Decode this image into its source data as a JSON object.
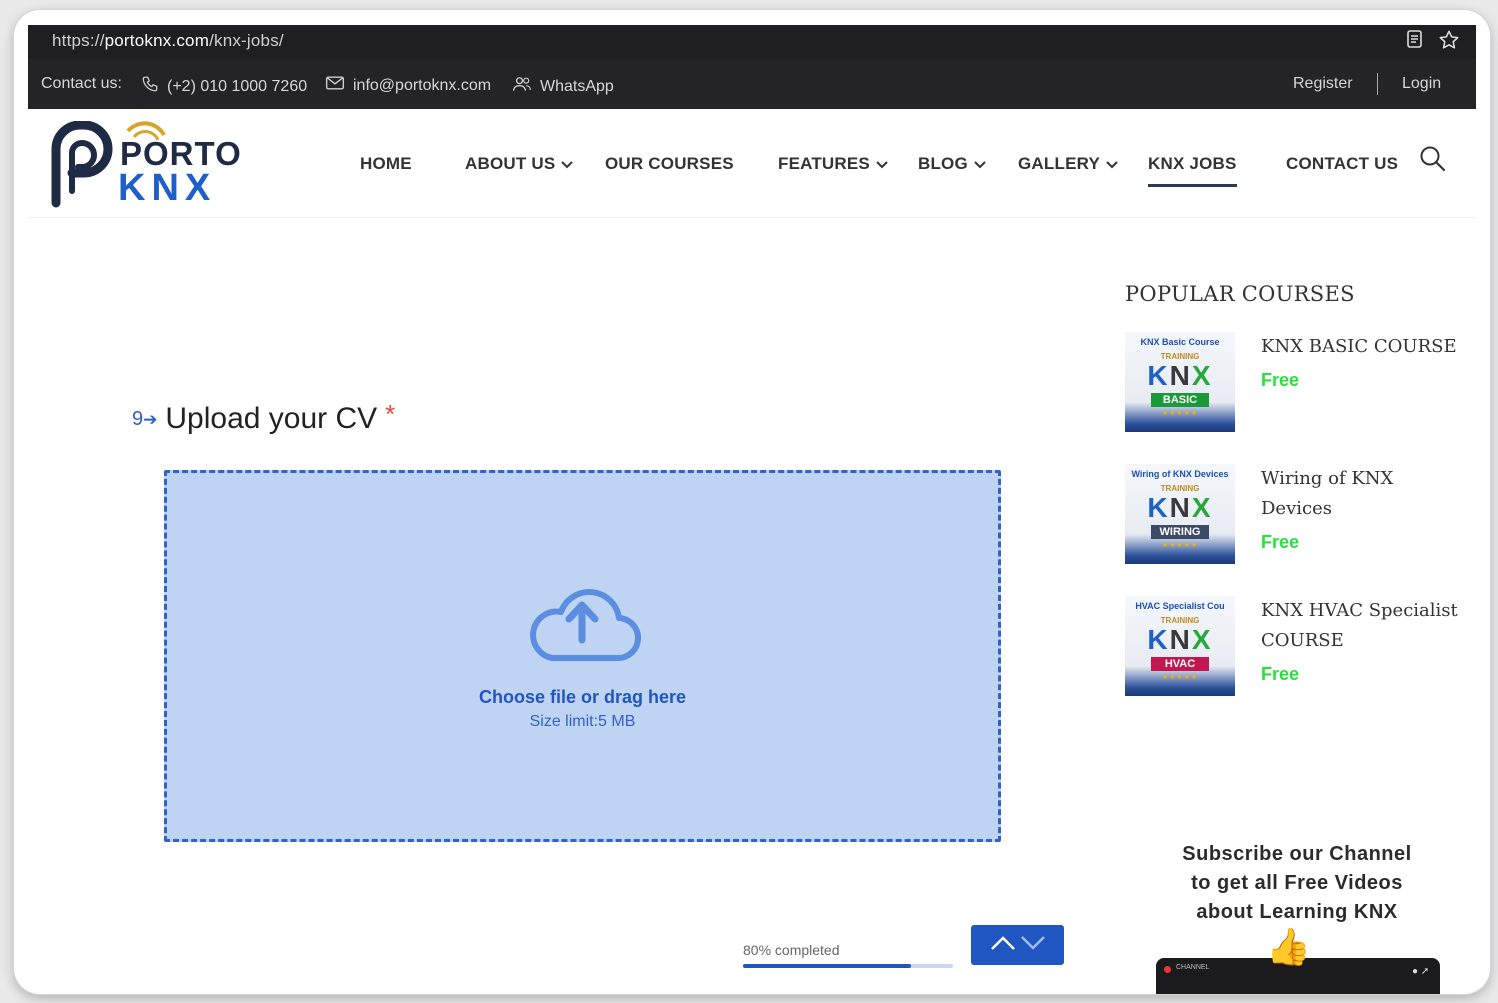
{
  "browser": {
    "url_prefix": "https://",
    "url_host": "portoknx.com",
    "url_path": "/knx-jobs/"
  },
  "topbar": {
    "contact_label": "Contact us:",
    "phone": "(+2) 010 1000 7260",
    "email": "info@portoknx.com",
    "whatsapp": "WhatsApp",
    "register": "Register",
    "login": "Login"
  },
  "logo": {
    "word1": "PORTO",
    "word2": "KNX"
  },
  "nav": {
    "items": [
      {
        "label": "HOME"
      },
      {
        "label": "ABOUT US"
      },
      {
        "label": "OUR COURSES"
      },
      {
        "label": "FEATURES"
      },
      {
        "label": "BLOG"
      },
      {
        "label": "GALLERY"
      },
      {
        "label": "KNX JOBS"
      },
      {
        "label": "CONTACT US"
      }
    ],
    "active": "KNX JOBS"
  },
  "form": {
    "question_number": "9",
    "question_title": "Upload your CV",
    "required_mark": "*",
    "dropzone_title": "Choose file or drag here",
    "dropzone_subtitle": "Size limit:5 MB",
    "progress_text": "80% completed",
    "progress_fraction": 0.8
  },
  "sidebar": {
    "title": "POPULAR COURSES",
    "courses": [
      {
        "name": "KNX BASIC COURSE",
        "price": "Free",
        "thumb_caption": "KNX Basic Course",
        "thumb_training": "TRAINING",
        "thumb_tag": "BASIC",
        "thumb_tag_color": "#1b9a3a"
      },
      {
        "name": "Wiring of KNX Devices",
        "price": "Free",
        "thumb_caption": "Wiring of KNX Devices",
        "thumb_training": "TRAINING",
        "thumb_tag": "WIRING",
        "thumb_tag_color": "#3b4a66"
      },
      {
        "name": "KNX HVAC Specialist COURSE",
        "price": "Free",
        "thumb_caption": "HVAC Specialist Cou",
        "thumb_training": "TRAINING",
        "thumb_tag": "HVAC",
        "thumb_tag_color": "#c2184f"
      }
    ],
    "thumb_knx": {
      "k": "K",
      "n": "N",
      "x": "X"
    },
    "thumb_stars": "★★★★★",
    "subscribe_lines": [
      "Subscribe our Channel",
      "to get all Free Videos",
      "about Learning KNX"
    ],
    "yt_label": "CHANNEL"
  },
  "colors": {
    "accent_blue": "#1f56c1",
    "price_green": "#27e23a",
    "required_red": "#e74c3c",
    "dropzone_bg": "#bfd3f2"
  }
}
